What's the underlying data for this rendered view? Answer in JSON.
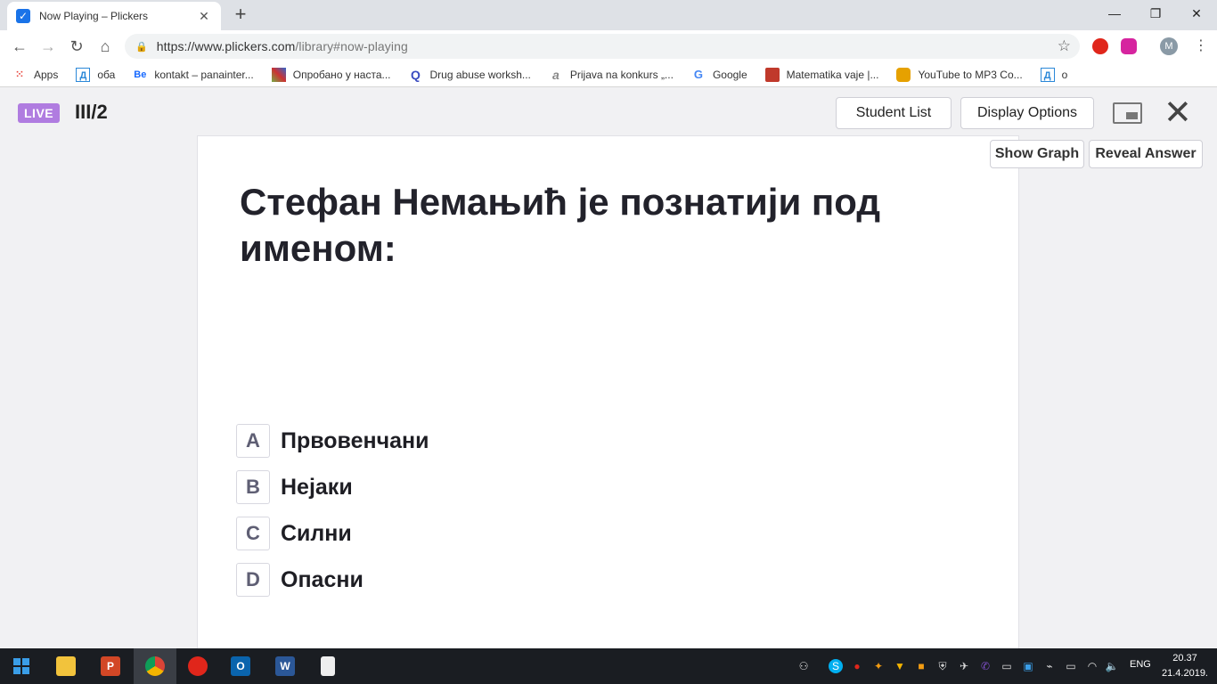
{
  "browser": {
    "tab_title": "Now Playing – Plickers",
    "tab_close": "✕",
    "new_tab": "+",
    "url_host": "https://www.plickers.com",
    "url_path": "/library#now-playing",
    "avatar_letter": "M",
    "bookmarks": [
      {
        "label": "Apps",
        "icon": "apps-grid-icon",
        "color": "#e8453c"
      },
      {
        "label": "оба",
        "icon": "bookmark-d-icon",
        "color": "#2b88d8"
      },
      {
        "label": "kontakt – panainter...",
        "icon": "behance-icon",
        "color": "#1769ff"
      },
      {
        "label": "Опробано у наста...",
        "icon": "mosaic-icon",
        "color": "#7a4"
      },
      {
        "label": "Drug abuse worksh...",
        "icon": "q-icon",
        "color": "#3b4cc0"
      },
      {
        "label": "Prijava na konkurs „...",
        "icon": "script-a-icon",
        "color": "#888"
      },
      {
        "label": "Google",
        "icon": "google-icon",
        "color": "#4285f4"
      },
      {
        "label": "Matematika vaje |...",
        "icon": "school-icon",
        "color": "#c0392b"
      },
      {
        "label": "YouTube to MP3 Co...",
        "icon": "camera-icon",
        "color": "#e6a100"
      },
      {
        "label": "o",
        "icon": "bookmark-d-icon",
        "color": "#2b88d8"
      }
    ]
  },
  "app": {
    "live_label": "LIVE",
    "class_name": "III/2",
    "student_list": "Student List",
    "display_options": "Display Options",
    "show_graph": "Show Graph",
    "reveal_answer": "Reveal Answer",
    "close": "✕",
    "question": "Стефан Немањић је познатији под именом:",
    "choices": [
      {
        "letter": "A",
        "text": "Првовенчани"
      },
      {
        "letter": "B",
        "text": "Нејаки"
      },
      {
        "letter": "C",
        "text": "Силни"
      },
      {
        "letter": "D",
        "text": "Опасни"
      }
    ]
  },
  "taskbar": {
    "language": "ENG",
    "time": "20.37",
    "date": "21.4.2019.",
    "accent": "#ffffff"
  }
}
